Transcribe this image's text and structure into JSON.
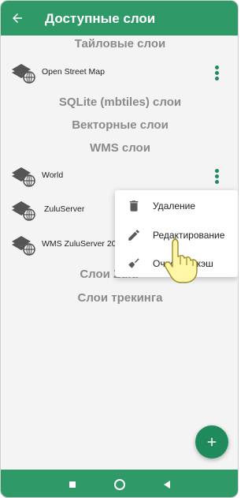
{
  "appbar": {
    "title": "Доступные слои",
    "back_icon": "arrow-left-icon"
  },
  "sections": {
    "tile": "Тайловые слои",
    "sqlite": "SQLite (mbtiles) слои",
    "vector": "Векторные слои",
    "wms": "WMS слои",
    "zulu": "Слои Zulu",
    "tracking": "Слои трекинга"
  },
  "layers": [
    {
      "name": "Open Street Map",
      "icon": "layers-globe-icon"
    },
    {
      "name": "World",
      "icon": "layers-globe-icon"
    },
    {
      "name": "ZuluServer",
      "icon": "layers-globe-icon"
    },
    {
      "name": "WMS ZuluServer 20",
      "icon": "layers-globe-icon"
    }
  ],
  "context_menu": {
    "items": [
      {
        "label": "Удаление",
        "icon": "trash-icon"
      },
      {
        "label": "Редактирование",
        "icon": "pencil-icon"
      },
      {
        "label": "Очистить кэш",
        "icon": "broom-icon"
      }
    ]
  },
  "fab": {
    "icon": "plus-icon"
  },
  "navbar": {
    "icons": [
      "square-icon",
      "circle-icon",
      "triangle-back-icon"
    ]
  },
  "colors": {
    "primary": "#2f9a68",
    "accent": "#1f8a5b",
    "background": "#f4f4f4",
    "section_text": "#8a8a8a"
  }
}
